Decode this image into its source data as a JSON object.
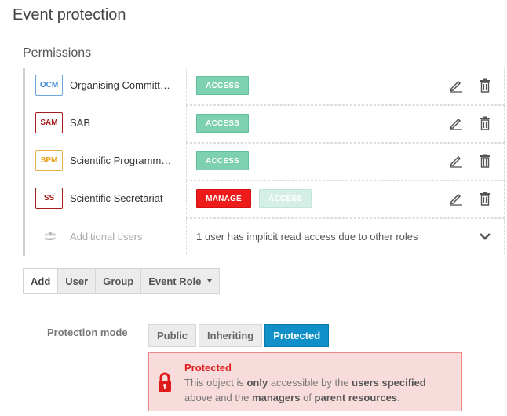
{
  "page": {
    "title": "Event protection"
  },
  "permissions": {
    "title": "Permissions",
    "rows": [
      {
        "badge": "OCM",
        "name": "Organising Committ…",
        "tags": [
          "ACCESS"
        ]
      },
      {
        "badge": "SAM",
        "name": "SAB",
        "tags": [
          "ACCESS"
        ]
      },
      {
        "badge": "SPM",
        "name": "Scientific Programm…",
        "tags": [
          "ACCESS"
        ]
      },
      {
        "badge": "SS",
        "name": "Scientific Secretariat",
        "tags": [
          "MANAGE",
          "ACCESS"
        ]
      }
    ],
    "additional": {
      "label": "Additional users",
      "note": "1 user has implicit read access due to other roles"
    }
  },
  "add_buttons": {
    "add": "Add",
    "user": "User",
    "group": "Group",
    "event_role": "Event Role"
  },
  "protection": {
    "label": "Protection mode",
    "modes": [
      "Public",
      "Inheriting",
      "Protected"
    ],
    "selected": "Protected",
    "alert": {
      "title": "Protected",
      "t1": "This object is ",
      "b1": "only",
      "t2": " accessible by the ",
      "b2": "users specified",
      "t3": " above and the ",
      "b3": "managers",
      "t4": " of ",
      "b4": "parent resources",
      "t5": "."
    }
  },
  "colors": {
    "access": "#7dd0b0",
    "manage": "#ee1b1b",
    "protected_active": "#1090c8",
    "alert_bg": "#f8dcdc"
  },
  "icons": {
    "edit": "pencil-icon",
    "delete": "trash-icon",
    "expand": "chevron-down-icon",
    "users": "users-icon",
    "lock": "lock-icon"
  }
}
